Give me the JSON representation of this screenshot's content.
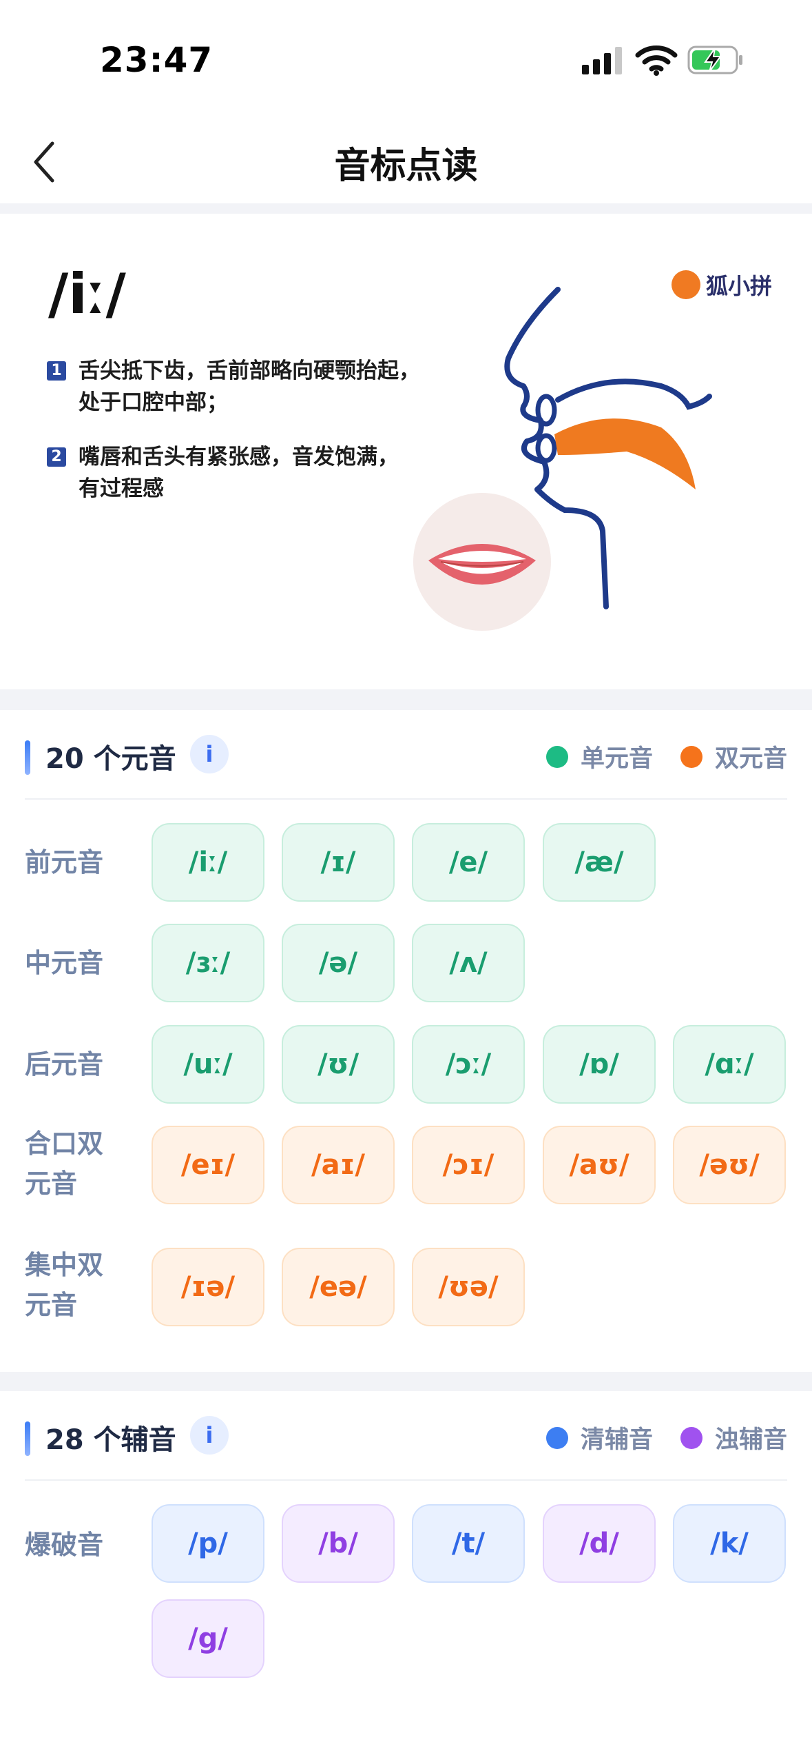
{
  "status": {
    "time": "23:47"
  },
  "nav": {
    "title": "音标点读"
  },
  "banner": {
    "symbol": "/iː/",
    "brand": "狐小拼",
    "tips": [
      {
        "num": "1",
        "line1": "舌尖抵下齿，舌前部略向硬颚抬起，",
        "line2": "处于口腔中部；"
      },
      {
        "num": "2",
        "line1": "嘴唇和舌头有紧张感，音发饱满，",
        "line2": "有过程感"
      }
    ]
  },
  "vowels": {
    "title": "20 个元音",
    "info": "i",
    "legend": [
      {
        "label": "单元音",
        "color": "#1dbb84"
      },
      {
        "label": "双元音",
        "color": "#f5731b"
      }
    ],
    "rows": [
      {
        "label": "前元音",
        "items": [
          "/iː/",
          "/ɪ/",
          "/e/",
          "/æ/"
        ]
      },
      {
        "label": "中元音",
        "items": [
          "/ɜː/",
          "/ə/",
          "/ʌ/"
        ]
      },
      {
        "label": "后元音",
        "items": [
          "/uː/",
          "/ʊ/",
          "/ɔː/",
          "/ɒ/",
          "/ɑː/"
        ]
      },
      {
        "label": "合口双元音",
        "items": [
          "/eɪ/",
          "/aɪ/",
          "/ɔɪ/",
          "/aʊ/",
          "/əʊ/"
        ]
      },
      {
        "label": "集中双元音",
        "items": [
          "/ɪə/",
          "/eə/",
          "/ʊə/"
        ]
      }
    ]
  },
  "consonants": {
    "title": "28 个辅音",
    "info": "i",
    "legend": [
      {
        "label": "清辅音",
        "color": "#3d7ef2"
      },
      {
        "label": "浊辅音",
        "color": "#a052ef"
      }
    ],
    "rows": [
      {
        "label": "爆破音",
        "items": [
          "/p/",
          "/b/",
          "/t/",
          "/d/",
          "/k/",
          "/g/"
        ]
      }
    ]
  }
}
